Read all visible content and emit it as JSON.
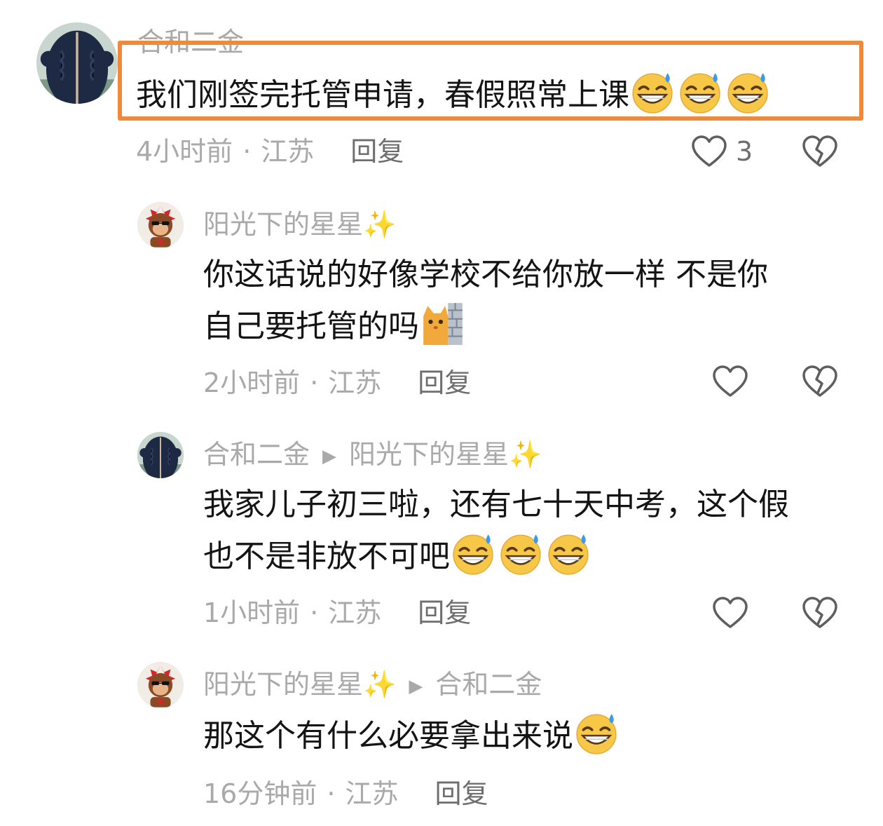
{
  "comments": [
    {
      "user": "合和二金",
      "text_lines": [
        "我们刚签完托管申请，春假照常上课"
      ],
      "emoji_count": 3,
      "time": "4小时前",
      "location": "江苏",
      "reply_label": "回复",
      "like_count": "3"
    },
    {
      "user": "阳光下的星星✨",
      "text_lines": [
        "你这话说的好像学校不给你放一样 不是你",
        "自己要托管的吗"
      ],
      "time": "2小时前",
      "location": "江苏",
      "reply_label": "回复"
    },
    {
      "user": "合和二金",
      "reply_to": "阳光下的星星✨",
      "text_lines": [
        "我家儿子初三啦，还有七十天中考，这个假",
        "也不是非放不可吧"
      ],
      "emoji_count": 3,
      "time": "1小时前",
      "location": "江苏",
      "reply_label": "回复"
    },
    {
      "user": "阳光下的星星✨",
      "reply_to": "合和二金",
      "text_lines": [
        "那这个有什么必要拿出来说"
      ],
      "emoji_count": 1,
      "time": "16分钟前",
      "location": "江苏",
      "reply_label": "回复"
    }
  ],
  "separator": "·",
  "icons": {
    "like": "heart-outline-icon",
    "dislike": "broken-heart-icon",
    "reply_arrow": "play-arrow-icon",
    "emoji": "grinning-sweat-emoji",
    "cat_emoji": "cat-peeking-wall-emoji"
  },
  "colors": {
    "highlight_border": "#ef8a3a",
    "meta_gray": "#a9a9a9",
    "text_black": "#141414"
  }
}
